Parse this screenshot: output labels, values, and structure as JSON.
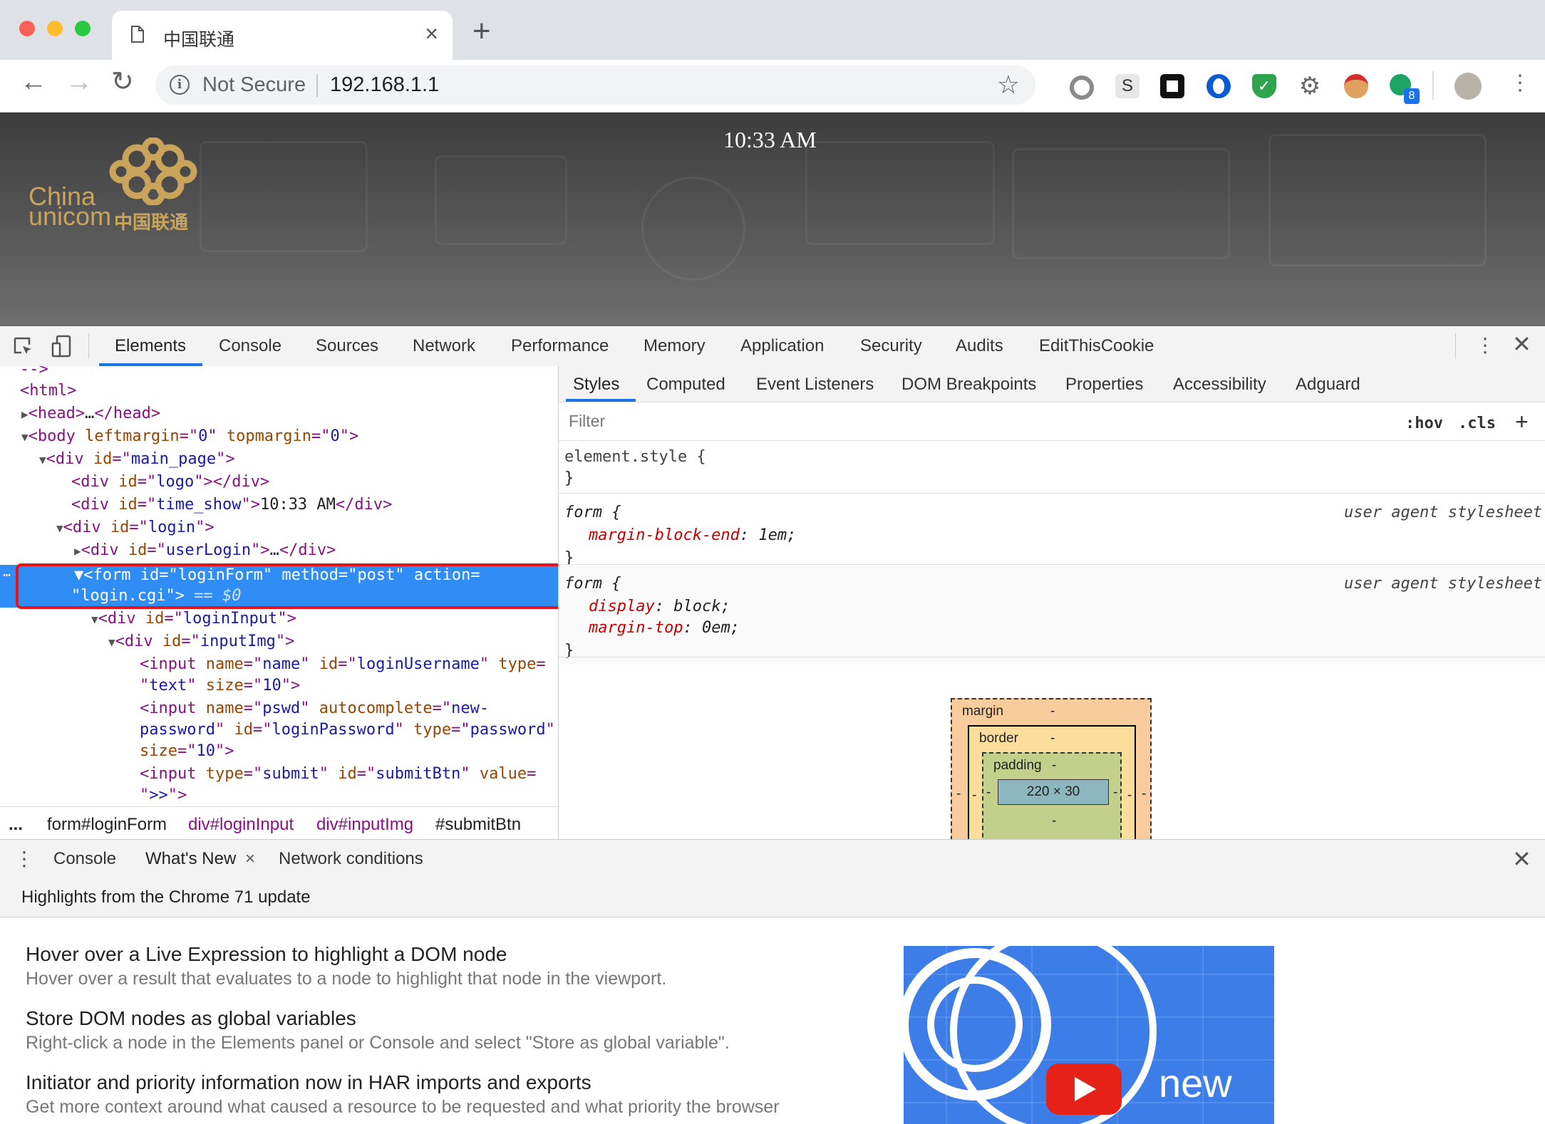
{
  "browser": {
    "tab_title": "中国联通",
    "tab_close": "×",
    "new_tab": "+",
    "not_secure": "Not Secure",
    "url": "192.168.1.1",
    "extension_badge": "8",
    "ext_s_label": "S"
  },
  "page": {
    "time_show": "10:33 AM",
    "logo_china": "China",
    "logo_unicom": "unicom",
    "logo_cn": "中国联通"
  },
  "devtools": {
    "tabs": [
      "Elements",
      "Console",
      "Sources",
      "Network",
      "Performance",
      "Memory",
      "Application",
      "Security",
      "Audits",
      "EditThisCookie"
    ],
    "active_tab": "Elements",
    "elements": {
      "comment_end": "-->",
      "html_open": "<html>",
      "head": "head",
      "body_tag": "body",
      "main_page_id": "main_page",
      "logo_id": "logo",
      "time_show_id": "time_show",
      "time_text": "10:33 AM",
      "login_id": "login",
      "userlogin_id": "userLogin",
      "form_id": "loginForm",
      "form_method": "post",
      "form_action": "login.cgi",
      "dollar_zero": "== $0",
      "logininput_id": "loginInput",
      "inputimg_id": "inputImg",
      "input1_name": "name",
      "input1_id": "loginUsername",
      "input1_type": "text",
      "input1_size": "10",
      "input2_name": "pswd",
      "input2_autocomplete_a": "new-",
      "input2_autocomplete_b": "password",
      "input2_id": "loginPassword",
      "input2_type": "password",
      "input2_size": "10",
      "input3_type": "submit",
      "input3_id": "submitBtn",
      "input3_value": ">>"
    },
    "breadcrumbs": [
      "...",
      "form#loginForm",
      "div#loginInput",
      "div#inputImg",
      "#submitBtn"
    ],
    "styles_tabs": [
      "Styles",
      "Computed",
      "Event Listeners",
      "DOM Breakpoints",
      "Properties",
      "Accessibility",
      "Adguard"
    ],
    "filter_placeholder": "Filter",
    "hov": ":hov",
    "cls": ".cls",
    "add": "+",
    "rules": {
      "element_style": "element.style {",
      "close_brace": "}",
      "rule1_selector": "form {",
      "rule1_source": "user agent stylesheet",
      "rule1_prop": "margin-block-end",
      "rule1_value": " 1em;",
      "rule2_selector": "form {",
      "rule2_source": "user agent stylesheet",
      "rule2_prop1": "display",
      "rule2_value1": " block;",
      "rule2_prop2": "margin-top",
      "rule2_value2": " 0em;"
    },
    "box_model": {
      "margin_label": "margin",
      "border_label": "border",
      "padding_label": "padding",
      "dash": "-",
      "content": "220 × 30"
    }
  },
  "drawer": {
    "tabs": [
      "Console",
      "What's New",
      "Network conditions"
    ],
    "active_tab": "What's New",
    "close_tab": "×",
    "header": "Highlights from the Chrome 71 update",
    "items": [
      {
        "title": "Hover over a Live Expression to highlight a DOM node",
        "desc": "Hover over a result that evaluates to a node to highlight that node in the viewport."
      },
      {
        "title": "Store DOM nodes as global variables",
        "desc": "Right-click a node in the Elements panel or Console and select \"Store as global variable\"."
      },
      {
        "title": "Initiator and priority information now in HAR imports and exports",
        "desc": "Get more context around what caused a resource to be requested and what priority the browser"
      }
    ],
    "video_text": "new"
  },
  "colors": {
    "accent": "#1a73e8",
    "selection": "#2f8df5",
    "highlight_box": "#e8141b",
    "unicom_gold": "#c9a45a"
  }
}
